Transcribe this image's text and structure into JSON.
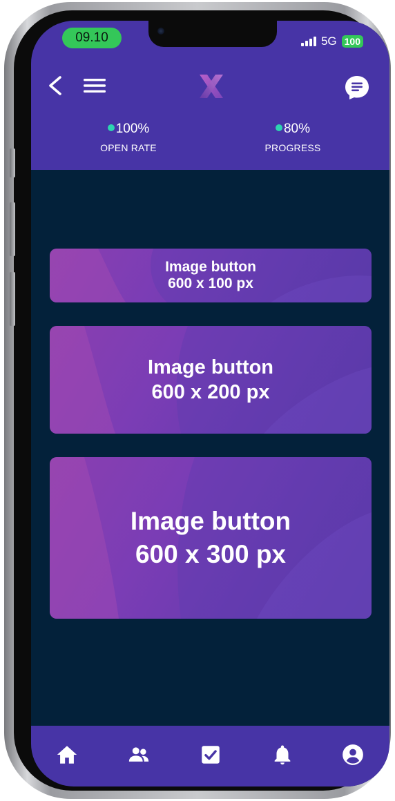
{
  "status_bar": {
    "time": "09.10",
    "network": "5G",
    "battery": "100"
  },
  "header": {
    "back_icon": "chevron-left-icon",
    "menu_icon": "hamburger-menu-icon",
    "logo_letter": "X",
    "chat_icon": "chat-bubble-icon",
    "metrics": [
      {
        "value": "100%",
        "label": "OPEN RATE"
      },
      {
        "value": "80%",
        "label": "PROGRESS"
      }
    ]
  },
  "image_buttons": [
    {
      "line1": "Image button",
      "line2": "600 x 100 px"
    },
    {
      "line1": "Image button",
      "line2": "600 x 200 px"
    },
    {
      "line1": "Image button",
      "line2": "600 x 300 px"
    }
  ],
  "tabbar": {
    "items": [
      {
        "icon": "home-icon"
      },
      {
        "icon": "people-icon"
      },
      {
        "icon": "checkbox-icon"
      },
      {
        "icon": "bell-icon"
      },
      {
        "icon": "profile-icon"
      }
    ]
  },
  "colors": {
    "header_bg": "#4734a6",
    "content_bg": "#03213a",
    "accent_dot": "#2dd4b0",
    "status_green": "#34c759"
  }
}
